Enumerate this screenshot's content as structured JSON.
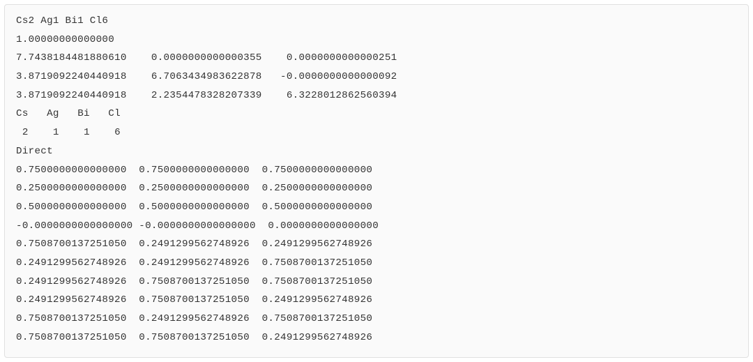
{
  "poscar": {
    "comment": "Cs2 Ag1 Bi1 Cl6",
    "scale": "1.00000000000000",
    "lattice": {
      "a": [
        "7.7438184481880610",
        "0.0000000000000355",
        "0.0000000000000251"
      ],
      "b": [
        "3.8719092240440918",
        "6.7063434983622878",
        "-0.0000000000000092"
      ],
      "c": [
        "3.8719092240440918",
        "2.2354478328207339",
        "6.3228012862560394"
      ]
    },
    "elements": [
      "Cs",
      "Ag",
      "Bi",
      "Cl"
    ],
    "counts": [
      "2",
      "1",
      "1",
      "6"
    ],
    "mode": "Direct",
    "positions": [
      [
        "0.7500000000000000",
        "0.7500000000000000",
        "0.7500000000000000"
      ],
      [
        "0.2500000000000000",
        "0.2500000000000000",
        "0.2500000000000000"
      ],
      [
        "0.5000000000000000",
        "0.5000000000000000",
        "0.5000000000000000"
      ],
      [
        "-0.0000000000000000",
        "-0.0000000000000000",
        "0.0000000000000000"
      ],
      [
        "0.7508700137251050",
        "0.2491299562748926",
        "0.2491299562748926"
      ],
      [
        "0.2491299562748926",
        "0.2491299562748926",
        "0.7508700137251050"
      ],
      [
        "0.2491299562748926",
        "0.7508700137251050",
        "0.7508700137251050"
      ],
      [
        "0.2491299562748926",
        "0.7508700137251050",
        "0.2491299562748926"
      ],
      [
        "0.7508700137251050",
        "0.2491299562748926",
        "0.7508700137251050"
      ],
      [
        "0.7508700137251050",
        "0.7508700137251050",
        "0.2491299562748926"
      ]
    ]
  }
}
